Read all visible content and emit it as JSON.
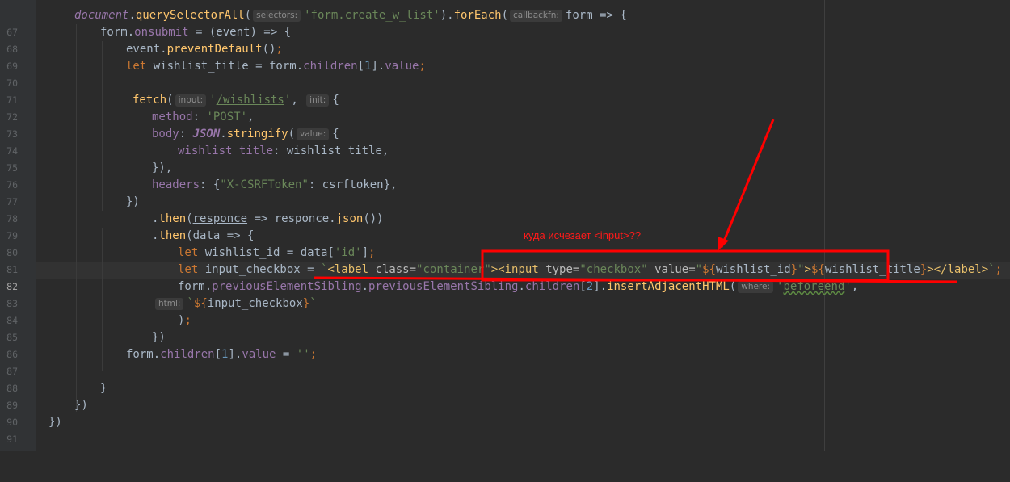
{
  "editor": {
    "line_numbers": [
      "67",
      "68",
      "69",
      "70",
      "71",
      "72",
      "73",
      "74",
      "75",
      "76",
      "77",
      "78",
      "79",
      "80",
      "81",
      "82",
      "83",
      "84",
      "85",
      "86",
      "87",
      "88",
      "89",
      "90",
      "91"
    ],
    "current_line": "82",
    "hints": {
      "selectors": "selectors:",
      "callbackfn": "callbackfn:",
      "input": "input:",
      "init": "init:",
      "value": "value:",
      "where": "where:",
      "html": "html:"
    }
  },
  "annotation": {
    "text": "куда исчезает <input>??",
    "color": "#ff1a1a"
  },
  "colors": {
    "background": "#2b2b2b",
    "keyword": "#cc7832",
    "string": "#6a8759",
    "number": "#6897bb",
    "property": "#9876aa",
    "function": "#ffc66d",
    "annotation": "#ff0000"
  }
}
